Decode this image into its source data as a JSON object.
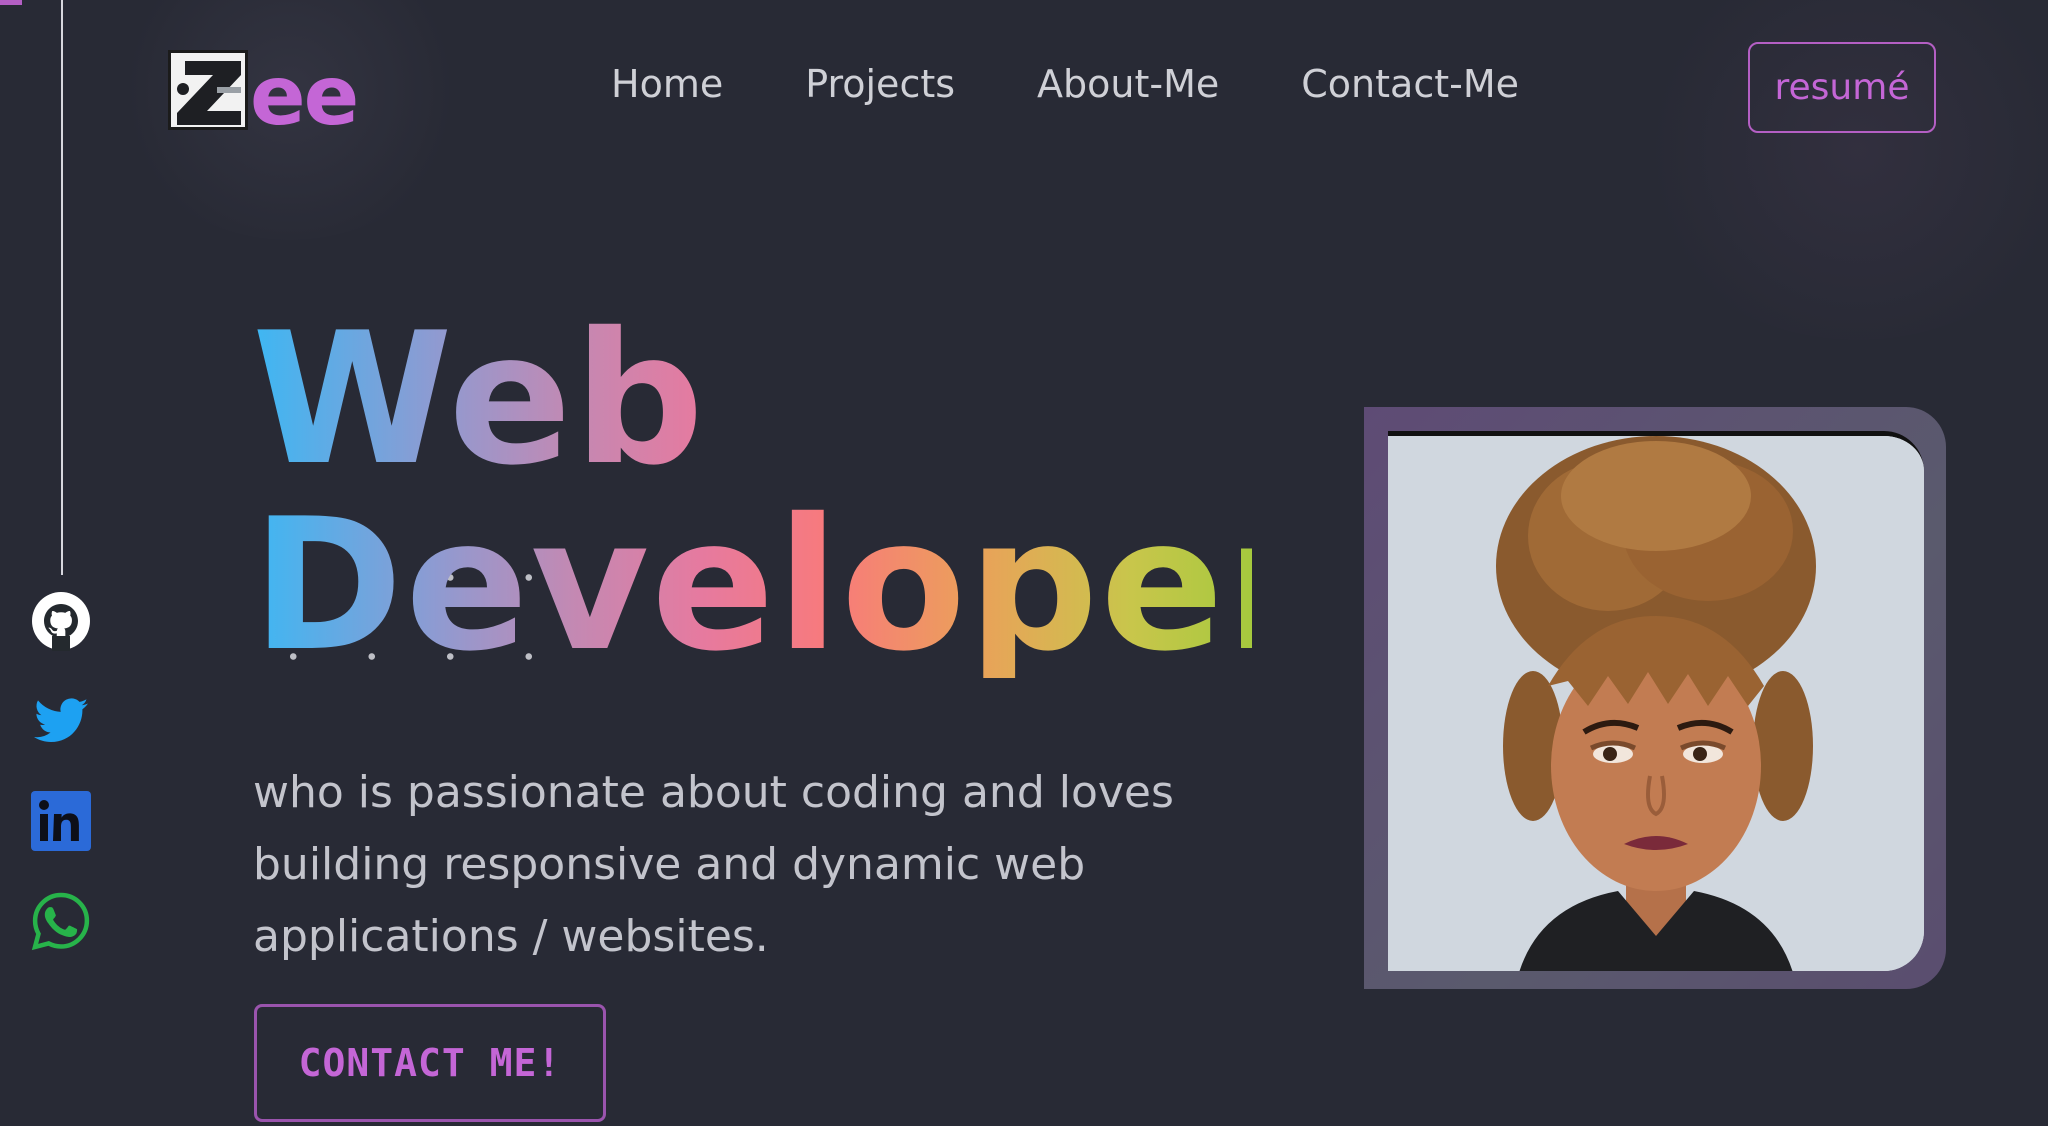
{
  "brand": {
    "logo_mark": "Z",
    "logo_text": "ee"
  },
  "nav": {
    "items": [
      {
        "label": "Home"
      },
      {
        "label": "Projects"
      },
      {
        "label": "About-Me"
      },
      {
        "label": "Contact-Me"
      }
    ],
    "resume_label": "resumé"
  },
  "social": [
    {
      "icon": "github-icon"
    },
    {
      "icon": "twitter-icon"
    },
    {
      "icon": "linkedin-icon"
    },
    {
      "icon": "whatsapp-icon"
    }
  ],
  "hero": {
    "title_line1": "Web",
    "title_line2": "Developer",
    "description": "who is passionate about coding and loves building responsive and dynamic web applications / websites.",
    "cta_label": "CONTACT ME!"
  },
  "colors": {
    "background": "#282a35",
    "accent": "#c466d6",
    "text": "#cfd0d6"
  }
}
